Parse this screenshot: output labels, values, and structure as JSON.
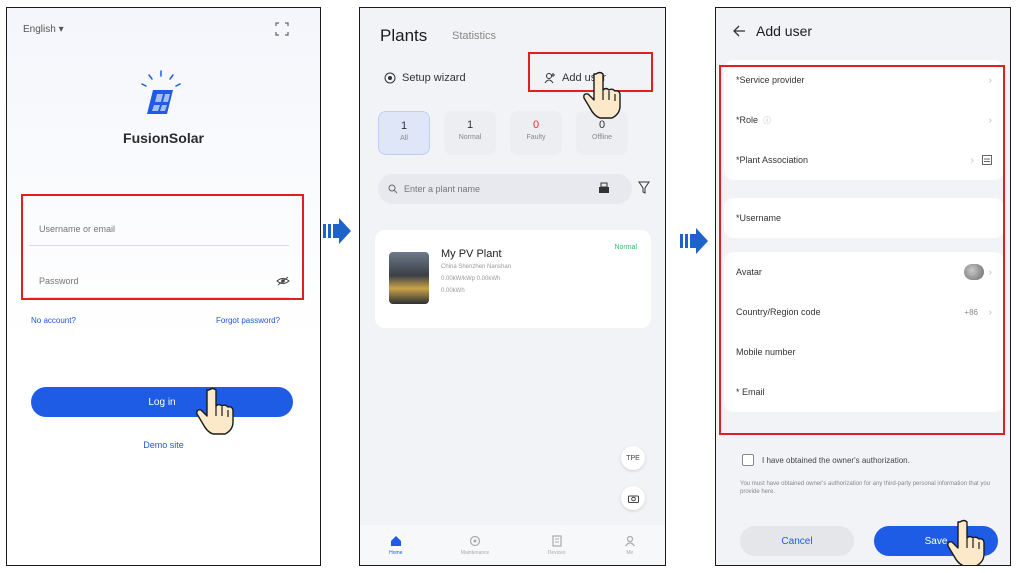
{
  "login": {
    "language": "English ▾",
    "app_name": "FusionSolar",
    "username_placeholder": "Username or email",
    "password_placeholder": "Password",
    "no_account": "No account?",
    "forgot_password": "Forgot password?",
    "login_label": "Log in",
    "demo_site": "Demo site"
  },
  "plants": {
    "title": "Plants",
    "statistics_tab": "Statistics",
    "setup_wizard": "Setup wizard",
    "add_user": "Add user",
    "filters": [
      {
        "count": "1",
        "label": "All"
      },
      {
        "count": "1",
        "label": "Normal"
      },
      {
        "count": "0",
        "label": "Faulty"
      },
      {
        "count": "0",
        "label": "Offline"
      }
    ],
    "search_placeholder": "Enter a plant name",
    "card": {
      "name": "My PV Plant",
      "status": "Normal",
      "line1": "China Shenzhen Nanshan",
      "line2": "0.00kW/kWp   0.00kWh",
      "line3": "0.00kWh"
    },
    "fab_label": "TPE",
    "nav": [
      "Home",
      "Maintenance",
      "Devices",
      "Me"
    ]
  },
  "add_user": {
    "title": "Add user",
    "rows_group1": [
      "*Service provider",
      "*Role",
      "*Plant Association"
    ],
    "username": "*Username",
    "avatar": "Avatar",
    "country_code": "Country/Region code",
    "country_code_value": "+86",
    "mobile": "Mobile number",
    "email": "* Email",
    "authorization": "I have obtained the owner's authorization.",
    "notice": "You must have obtained owner's authorization for any third-party personal information that you provide here.",
    "cancel": "Cancel",
    "save": "Save"
  },
  "colors": {
    "accent": "#1e5ce6",
    "highlight": "#e02020",
    "arrow": "#1e63c9"
  }
}
